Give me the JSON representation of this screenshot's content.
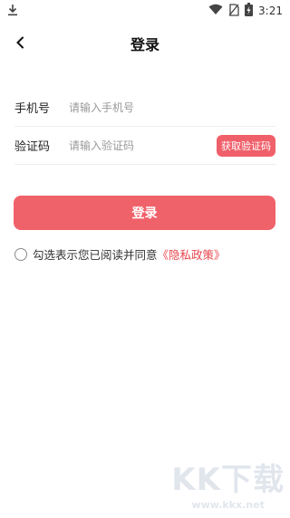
{
  "status_bar": {
    "time": "3:21",
    "icons": [
      "download-icon",
      "wifi-icon",
      "no-sim-icon",
      "battery-icon"
    ]
  },
  "header": {
    "back_icon": "chevron-left-icon",
    "title": "登录"
  },
  "form": {
    "phone_label": "手机号",
    "phone_placeholder": "请输入手机号",
    "code_label": "验证码",
    "code_placeholder": "请输入验证码",
    "get_code_label": "获取验证码"
  },
  "login_button": "登录",
  "agreement": {
    "text": "勾选表示您已阅读并同意",
    "link": "《隐私政策》"
  },
  "watermark": {
    "logo": "KK下载",
    "url": "www.kkx.net"
  },
  "colors": {
    "accent": "#f0626a",
    "link": "#e8474f"
  }
}
